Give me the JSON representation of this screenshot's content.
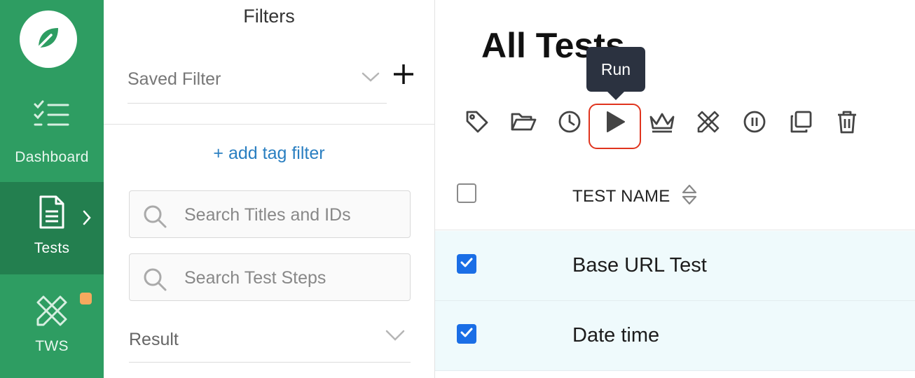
{
  "sidebar": {
    "logo_icon": "leaf-icon",
    "items": [
      {
        "label": "Dashboard",
        "icon": "checklist-icon"
      },
      {
        "label": "Tests",
        "icon": "document-icon",
        "active": true
      },
      {
        "label": "TWS",
        "icon": "pencil-ruler-icon",
        "badge_color": "#f6a95e"
      }
    ],
    "bg_color": "#2e9d62",
    "active_bg_color": "#237f4f"
  },
  "filters": {
    "title": "Filters",
    "saved_filter_label": "Saved Filter",
    "add_tag_filter": "+ add tag filter",
    "search_titles_placeholder": "Search Titles and IDs",
    "search_steps_placeholder": "Search Test Steps",
    "result_label": "Result"
  },
  "main": {
    "title": "All Tests",
    "toolbar": [
      {
        "name": "tag-icon"
      },
      {
        "name": "folder-open-icon"
      },
      {
        "name": "clock-icon"
      },
      {
        "name": "play-icon",
        "highlighted": true
      },
      {
        "name": "crown-icon"
      },
      {
        "name": "pencil-ruler-icon"
      },
      {
        "name": "pause-circle-icon"
      },
      {
        "name": "copy-icon"
      },
      {
        "name": "trash-icon"
      }
    ],
    "tooltip": "Run",
    "table": {
      "header": "TEST NAME",
      "rows": [
        {
          "name": "Base URL Test",
          "checked": true
        },
        {
          "name": "Date time",
          "checked": true
        }
      ]
    }
  },
  "colors": {
    "accent_blue": "#2a7fc1",
    "checkbox_blue": "#1a6ee6",
    "highlight_red": "#e0341e",
    "row_bg": "#effafc",
    "tooltip_bg": "#2b3240"
  }
}
